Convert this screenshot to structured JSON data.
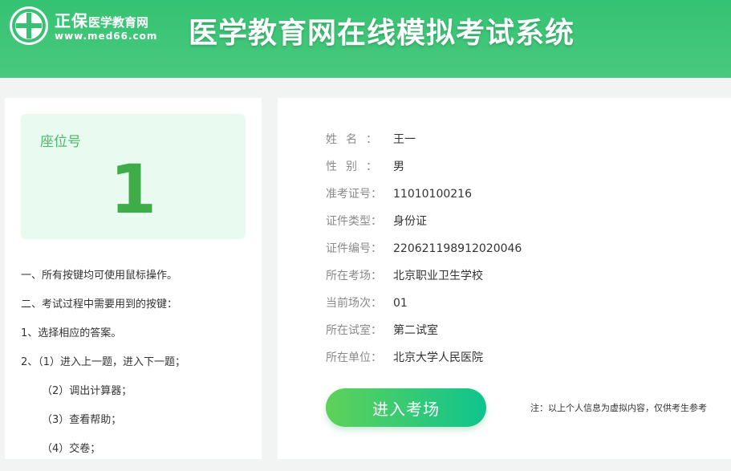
{
  "header": {
    "logo_brand": "正保",
    "logo_brand_small": "医学教育网",
    "logo_url": "www.med66.com",
    "title": "医学教育网在线模拟考试系统",
    "logo_icon": "med66-cross-logo-icon"
  },
  "seat": {
    "label": "座位号",
    "number": "1"
  },
  "instructions": [
    "一、所有按键均可使用鼠标操作。",
    "二、考试过程中需要用到的按键：",
    "1、选择相应的答案。",
    "2、（1）进入上一题，进入下一题；",
    "（2）调出计算器；",
    "（3）查看帮助；",
    "（4）交卷；"
  ],
  "candidate": {
    "rows": [
      {
        "label": "姓名：",
        "value": "王一"
      },
      {
        "label": "性别：",
        "value": "男"
      },
      {
        "label": "准考证号：",
        "value": "11010100216"
      },
      {
        "label": "证件类型：",
        "value": "身份证"
      },
      {
        "label": "证件编号：",
        "value": "220621198912020046"
      },
      {
        "label": "所在考场：",
        "value": "北京职业卫生学校"
      },
      {
        "label": "当前场次：",
        "value": "01"
      },
      {
        "label": "所在试室：",
        "value": "第二试室"
      },
      {
        "label": "所在单位：",
        "value": "北京大学人民医院"
      }
    ]
  },
  "actions": {
    "enter_label": "进入考场"
  },
  "note": "注：以上个人信息为虚拟内容，仅供考生参考",
  "colors": {
    "header_green": "#35c273",
    "seat_green": "#3fad47",
    "seat_bg": "#e9fbf1",
    "button_start": "#5fd15a",
    "button_end": "#0fc48e"
  }
}
